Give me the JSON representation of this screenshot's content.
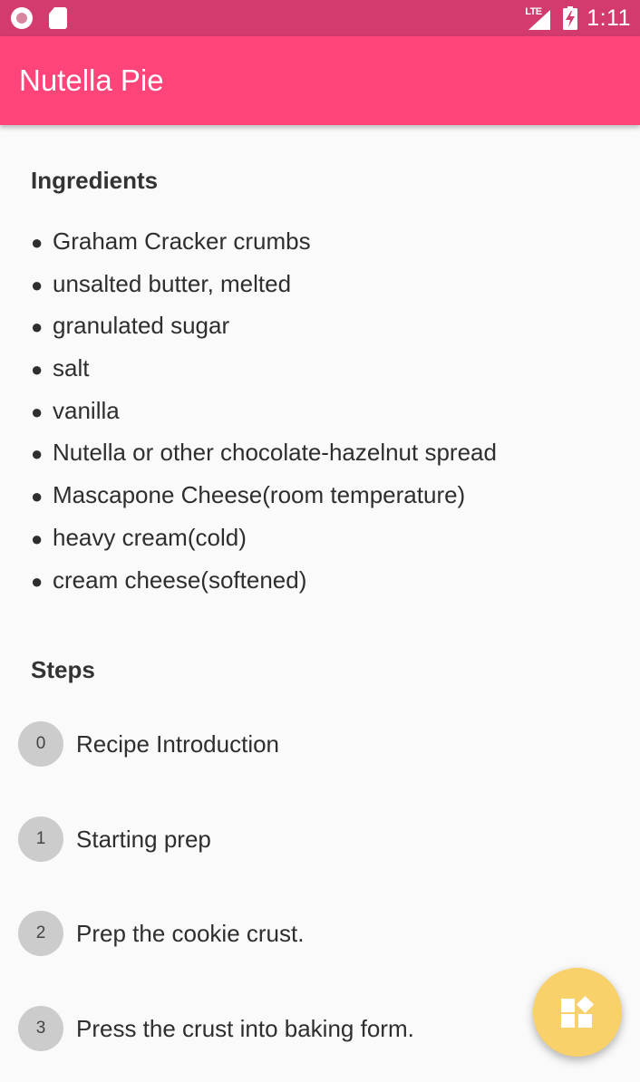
{
  "status_bar": {
    "time": "1:11",
    "network_label": "LTE",
    "icons": [
      "record-icon",
      "sd-card-icon",
      "signal-icon",
      "battery-charging-icon"
    ]
  },
  "app_bar": {
    "title": "Nutella Pie",
    "color": "#fe4479"
  },
  "ingredients": {
    "title": "Ingredients",
    "bullet": "●",
    "items": [
      "Graham Cracker crumbs",
      "unsalted butter, melted",
      "granulated sugar",
      "salt",
      "vanilla",
      "Nutella or other chocolate-hazelnut spread",
      "Mascapone Cheese(room temperature)",
      "heavy cream(cold)",
      "cream cheese(softened)"
    ]
  },
  "steps": {
    "title": "Steps",
    "items": [
      {
        "number": "0",
        "label": "Recipe Introduction"
      },
      {
        "number": "1",
        "label": "Starting prep"
      },
      {
        "number": "2",
        "label": "Prep the cookie crust."
      },
      {
        "number": "3",
        "label": "Press the crust into baking form."
      }
    ]
  },
  "fab": {
    "icon": "widgets-icon",
    "color": "#f9d16a"
  }
}
